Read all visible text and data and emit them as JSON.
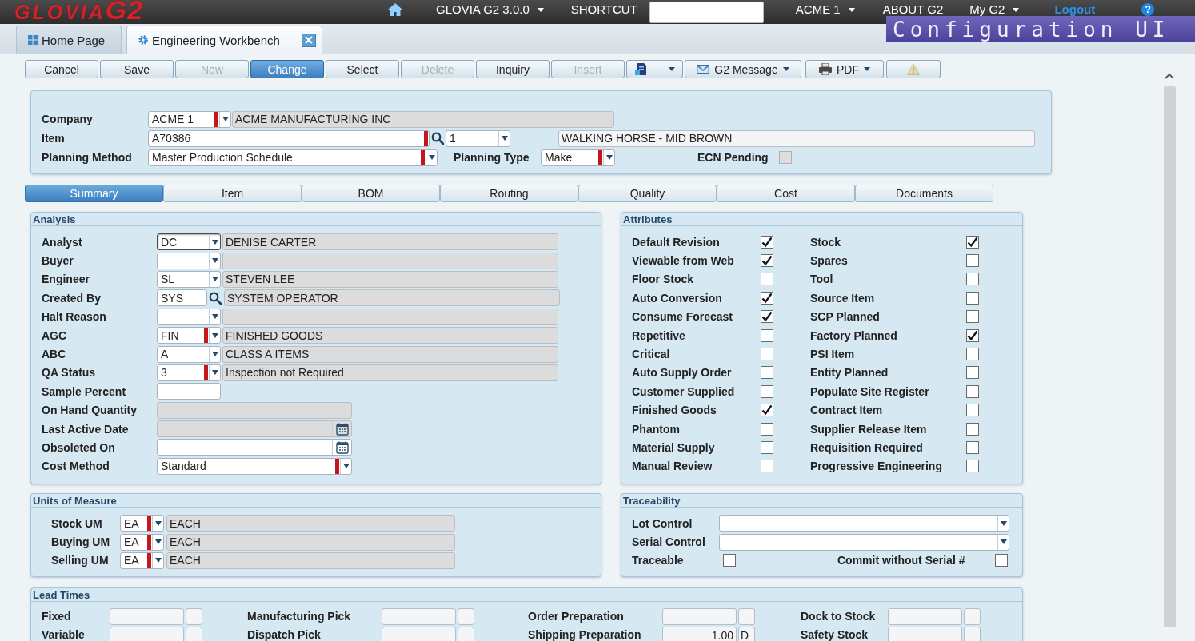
{
  "top_bar": {
    "logo": {
      "name": "GLOVIA",
      "mark": "G2"
    },
    "nav": [
      {
        "kind": "home"
      },
      {
        "kind": "menu",
        "label": "GLOVIA G2 3.0.0"
      },
      {
        "kind": "link",
        "label": "SHORTCUT"
      },
      {
        "kind": "field"
      },
      {
        "kind": "menu",
        "label": "ACME 1"
      },
      {
        "kind": "link",
        "label": "ABOUT G2"
      },
      {
        "kind": "menu",
        "label": "My G2"
      },
      {
        "kind": "highlight",
        "label": "Logout"
      },
      {
        "kind": "help",
        "label": "?"
      }
    ]
  },
  "caption_banner": "Configuration UI",
  "window_tabs": [
    {
      "kind": "dashboard",
      "label": "Home Page",
      "selected": false,
      "closable": false
    },
    {
      "kind": "workbench",
      "label": "Engineering Workbench",
      "selected": true,
      "closable": true
    }
  ],
  "toolbar": [
    {
      "kind": "button",
      "label": "Cancel",
      "disabled": false,
      "active": false
    },
    {
      "kind": "button",
      "label": "Save",
      "disabled": false,
      "active": false
    },
    {
      "kind": "button",
      "label": "New",
      "disabled": true,
      "active": false
    },
    {
      "kind": "button",
      "label": "Change",
      "disabled": false,
      "active": true
    },
    {
      "kind": "button",
      "label": "Select",
      "disabled": false,
      "active": false
    },
    {
      "kind": "button",
      "label": "Delete",
      "disabled": true,
      "active": false
    },
    {
      "kind": "button",
      "label": "Inquiry",
      "disabled": false,
      "active": false
    },
    {
      "kind": "button",
      "label": "Insert",
      "disabled": true,
      "active": false
    },
    {
      "kind": "attach-menu",
      "disabled": false,
      "active": false
    },
    {
      "kind": "message-menu",
      "label": "G2 Message",
      "disabled": false,
      "active": false
    },
    {
      "kind": "print-menu",
      "label": "PDF",
      "disabled": false,
      "active": false
    },
    {
      "kind": "alert",
      "disabled": true,
      "active": false
    }
  ],
  "header": {
    "company": {
      "label": "Company",
      "value": "ACME 1",
      "required": true,
      "description": "ACME MANUFACTURING INC"
    },
    "item": {
      "label": "Item",
      "value": "A70386",
      "required": true,
      "revision": "1",
      "description": "WALKING HORSE - MID BROWN"
    },
    "planning_method": {
      "label": "Planning Method",
      "value": "Master Production Schedule",
      "required": true
    },
    "planning_type": {
      "label": "Planning Type",
      "value": "Make",
      "required": true
    },
    "ecn_pending": {
      "label": "ECN Pending",
      "checked": false,
      "disabled": true
    }
  },
  "detail_tabs": [
    {
      "label": "Summary",
      "selected": true
    },
    {
      "label": "Item",
      "selected": false
    },
    {
      "label": "BOM",
      "selected": false
    },
    {
      "label": "Routing",
      "selected": false
    },
    {
      "label": "Quality",
      "selected": false
    },
    {
      "label": "Cost",
      "selected": false
    },
    {
      "label": "Documents",
      "selected": false
    }
  ],
  "analysis": {
    "title": "Analysis",
    "rows": [
      {
        "kind": "select",
        "label": "Analyst",
        "value": "DC",
        "description": "DENISE CARTER",
        "required": false,
        "focused": true,
        "disabled": false
      },
      {
        "kind": "select",
        "label": "Buyer",
        "required": false,
        "focused": false,
        "disabled": false
      },
      {
        "kind": "select",
        "label": "Engineer",
        "value": "SL",
        "description": "STEVEN LEE",
        "required": false,
        "focused": false,
        "disabled": false
      },
      {
        "kind": "lookup",
        "label": "Created By",
        "value": "SYS",
        "description": "SYSTEM OPERATOR",
        "required": false,
        "focused": false,
        "disabled": false
      },
      {
        "kind": "select",
        "label": "Halt Reason",
        "required": false,
        "focused": false,
        "disabled": false
      },
      {
        "kind": "select",
        "label": "AGC",
        "value": "FIN",
        "description": "FINISHED GOODS",
        "required": true,
        "focused": false,
        "disabled": false
      },
      {
        "kind": "select",
        "label": "ABC",
        "value": "A",
        "description": "CLASS A ITEMS",
        "required": false,
        "focused": false,
        "disabled": false
      },
      {
        "kind": "select",
        "label": "QA Status",
        "value": "3",
        "description": "Inspection not Required",
        "required": true,
        "focused": false,
        "disabled": false
      },
      {
        "kind": "input",
        "label": "Sample Percent",
        "required": false,
        "focused": false,
        "disabled": false
      },
      {
        "kind": "quantity",
        "label": "On Hand Quantity",
        "required": false,
        "focused": false,
        "disabled": true
      },
      {
        "kind": "date",
        "label": "Last Active Date",
        "required": false,
        "focused": false,
        "disabled": true
      },
      {
        "kind": "date",
        "label": "Obsoleted On",
        "required": false,
        "focused": false,
        "disabled": false
      },
      {
        "kind": "list",
        "label": "Cost Method",
        "value": "Standard",
        "required": true,
        "focused": false,
        "disabled": false
      }
    ]
  },
  "attributes": {
    "title": "Attributes",
    "items": [
      {
        "label": "Default Revision",
        "checked": true
      },
      {
        "label": "Stock",
        "checked": true
      },
      {
        "label": "Viewable from Web",
        "checked": true
      },
      {
        "label": "Spares",
        "checked": false
      },
      {
        "label": "Floor Stock",
        "checked": false
      },
      {
        "label": "Tool",
        "checked": false
      },
      {
        "label": "Auto Conversion",
        "checked": true
      },
      {
        "label": "Source Item",
        "checked": false
      },
      {
        "label": "Consume Forecast",
        "checked": true
      },
      {
        "label": "SCP Planned",
        "checked": false
      },
      {
        "label": "Repetitive",
        "checked": false
      },
      {
        "label": "Factory Planned",
        "checked": true
      },
      {
        "label": "Critical",
        "checked": false
      },
      {
        "label": "PSI Item",
        "checked": false
      },
      {
        "label": "Auto Supply Order",
        "checked": false
      },
      {
        "label": "Entity Planned",
        "checked": false
      },
      {
        "label": "Customer Supplied",
        "checked": false
      },
      {
        "label": "Populate Site Register",
        "checked": false
      },
      {
        "label": "Finished Goods",
        "checked": true
      },
      {
        "label": "Contract Item",
        "checked": false
      },
      {
        "label": "Phantom",
        "checked": false
      },
      {
        "label": "Supplier Release Item",
        "checked": false
      },
      {
        "label": "Material Supply",
        "checked": false
      },
      {
        "label": "Requisition Required",
        "checked": false
      },
      {
        "label": "Manual Review",
        "checked": false
      },
      {
        "label": "Progressive Engineering",
        "checked": false
      }
    ]
  },
  "units_of_measure": {
    "title": "Units of Measure",
    "rows": [
      {
        "label": "Stock UM",
        "value": "EA",
        "description": "EACH",
        "required": true
      },
      {
        "label": "Buying UM",
        "value": "EA",
        "description": "EACH",
        "required": true
      },
      {
        "label": "Selling UM",
        "value": "EA",
        "description": "EACH",
        "required": true
      }
    ]
  },
  "traceability": {
    "title": "Traceability",
    "lists": [
      {
        "label": "Lot Control"
      },
      {
        "label": "Serial Control"
      }
    ],
    "checks": [
      {
        "label": "Traceable",
        "checked": false
      },
      {
        "label": "Commit without Serial #",
        "checked": false
      }
    ]
  },
  "lead_times": {
    "title": "Lead Times",
    "items": [
      {
        "label": "Fixed"
      },
      {
        "label": "Manufacturing Pick"
      },
      {
        "label": "Order Preparation"
      },
      {
        "label": "Dock to Stock"
      },
      {
        "label": "Variable"
      },
      {
        "label": "Dispatch Pick"
      },
      {
        "label": "Shipping Preparation",
        "value": "1.00",
        "unit": "D"
      },
      {
        "label": "Safety Stock"
      }
    ]
  }
}
